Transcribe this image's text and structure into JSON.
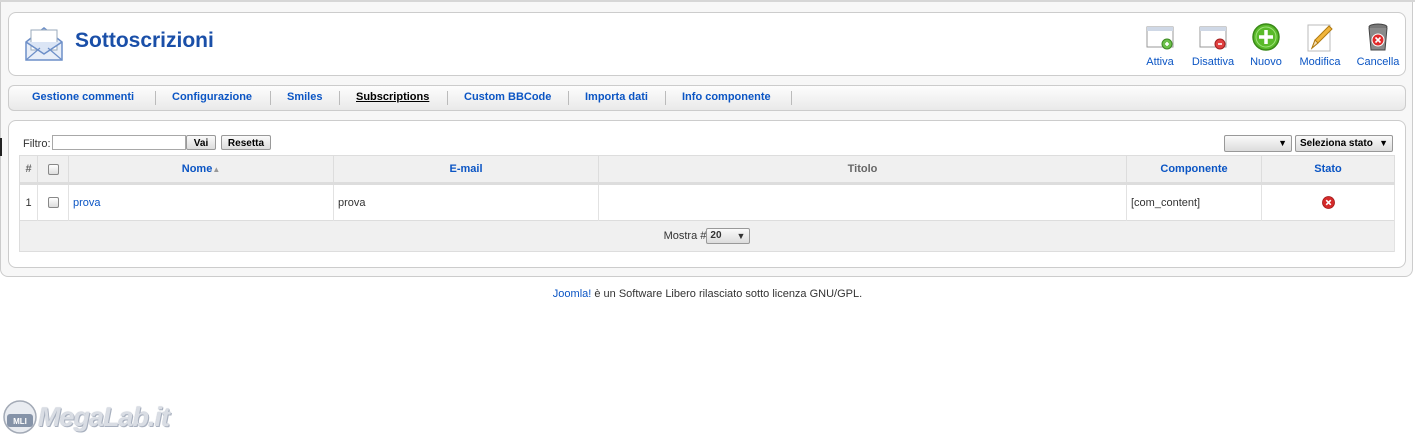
{
  "header": {
    "title": "Sottoscrizioni",
    "icon": "mail-envelope-icon",
    "toolbar": [
      {
        "id": "activate",
        "label": "Attiva",
        "icon": "activate-icon"
      },
      {
        "id": "deactivate",
        "label": "Disattiva",
        "icon": "deactivate-icon"
      },
      {
        "id": "new",
        "label": "Nuovo",
        "icon": "plus-icon"
      },
      {
        "id": "edit",
        "label": "Modifica",
        "icon": "pencil-icon"
      },
      {
        "id": "delete",
        "label": "Cancella",
        "icon": "trash-icon"
      }
    ]
  },
  "submenu": {
    "items": [
      {
        "label": "Gestione commenti",
        "active": false
      },
      {
        "label": "Configurazione",
        "active": false
      },
      {
        "label": "Smiles",
        "active": false
      },
      {
        "label": "Subscriptions",
        "active": true
      },
      {
        "label": "Custom BBCode",
        "active": false
      },
      {
        "label": "Importa dati",
        "active": false
      },
      {
        "label": "Info componente",
        "active": false
      }
    ]
  },
  "filter": {
    "label": "Filtro:",
    "value": "",
    "go_label": "Vai",
    "reset_label": "Resetta",
    "select1_value": "",
    "status_select_value": "Seleziona stato"
  },
  "table": {
    "headers": {
      "num": "#",
      "name": "Nome",
      "email": "E-mail",
      "title": "Titolo",
      "component": "Componente",
      "status": "Stato"
    },
    "sort": {
      "column": "name",
      "direction": "asc"
    },
    "rows": [
      {
        "num": "1",
        "name": "prova",
        "email": "prova",
        "title": "",
        "component": "[com_content]",
        "status": "disabled",
        "status_icon": "red-x-icon"
      }
    ],
    "footer": {
      "label": "Mostra #",
      "per_page": "20"
    }
  },
  "footer": {
    "link": "Joomla!",
    "text": " è un Software Libero rilasciato sotto licenza GNU/GPL."
  },
  "watermark": {
    "text": "MegaLab.it",
    "badge": "MLI"
  },
  "colors": {
    "link": "#0b55c4",
    "title": "#1a4fa8",
    "status_red": "#d42a2a",
    "new_green": "#5aba2a"
  }
}
